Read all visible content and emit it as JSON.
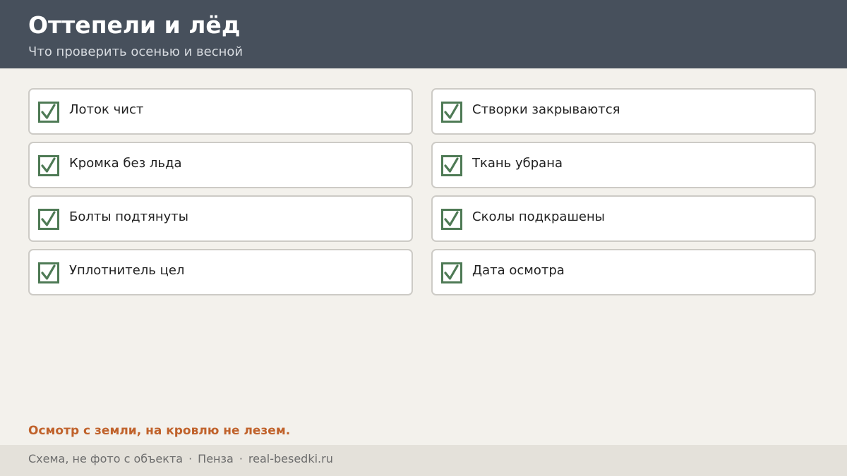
{
  "header": {
    "title": "Оттепели и лёд",
    "subtitle": "Что проверить осенью и весной"
  },
  "checklist": {
    "items": [
      {
        "label": "Лоток чист",
        "checked": true
      },
      {
        "label": "Створки закрываются",
        "checked": true
      },
      {
        "label": "Кромка без льда",
        "checked": true
      },
      {
        "label": "Ткань убрана",
        "checked": true
      },
      {
        "label": "Болты подтянуты",
        "checked": true
      },
      {
        "label": "Сколы подкрашены",
        "checked": true
      },
      {
        "label": "Уплотнитель цел",
        "checked": true
      },
      {
        "label": "Дата осмотра",
        "checked": true
      }
    ]
  },
  "warning": "Осмотр с земли, на кровлю не лезем.",
  "footer": {
    "note": "Схема, не фото с объекта",
    "separator": "·",
    "city": "Пенза",
    "site": "real-besedki.ru"
  },
  "colors": {
    "header_bg": "#47505c",
    "check_green": "#4e7a55",
    "warning_orange": "#c0622b"
  },
  "icons": {
    "checkbox": "checkbox-checked-icon"
  }
}
